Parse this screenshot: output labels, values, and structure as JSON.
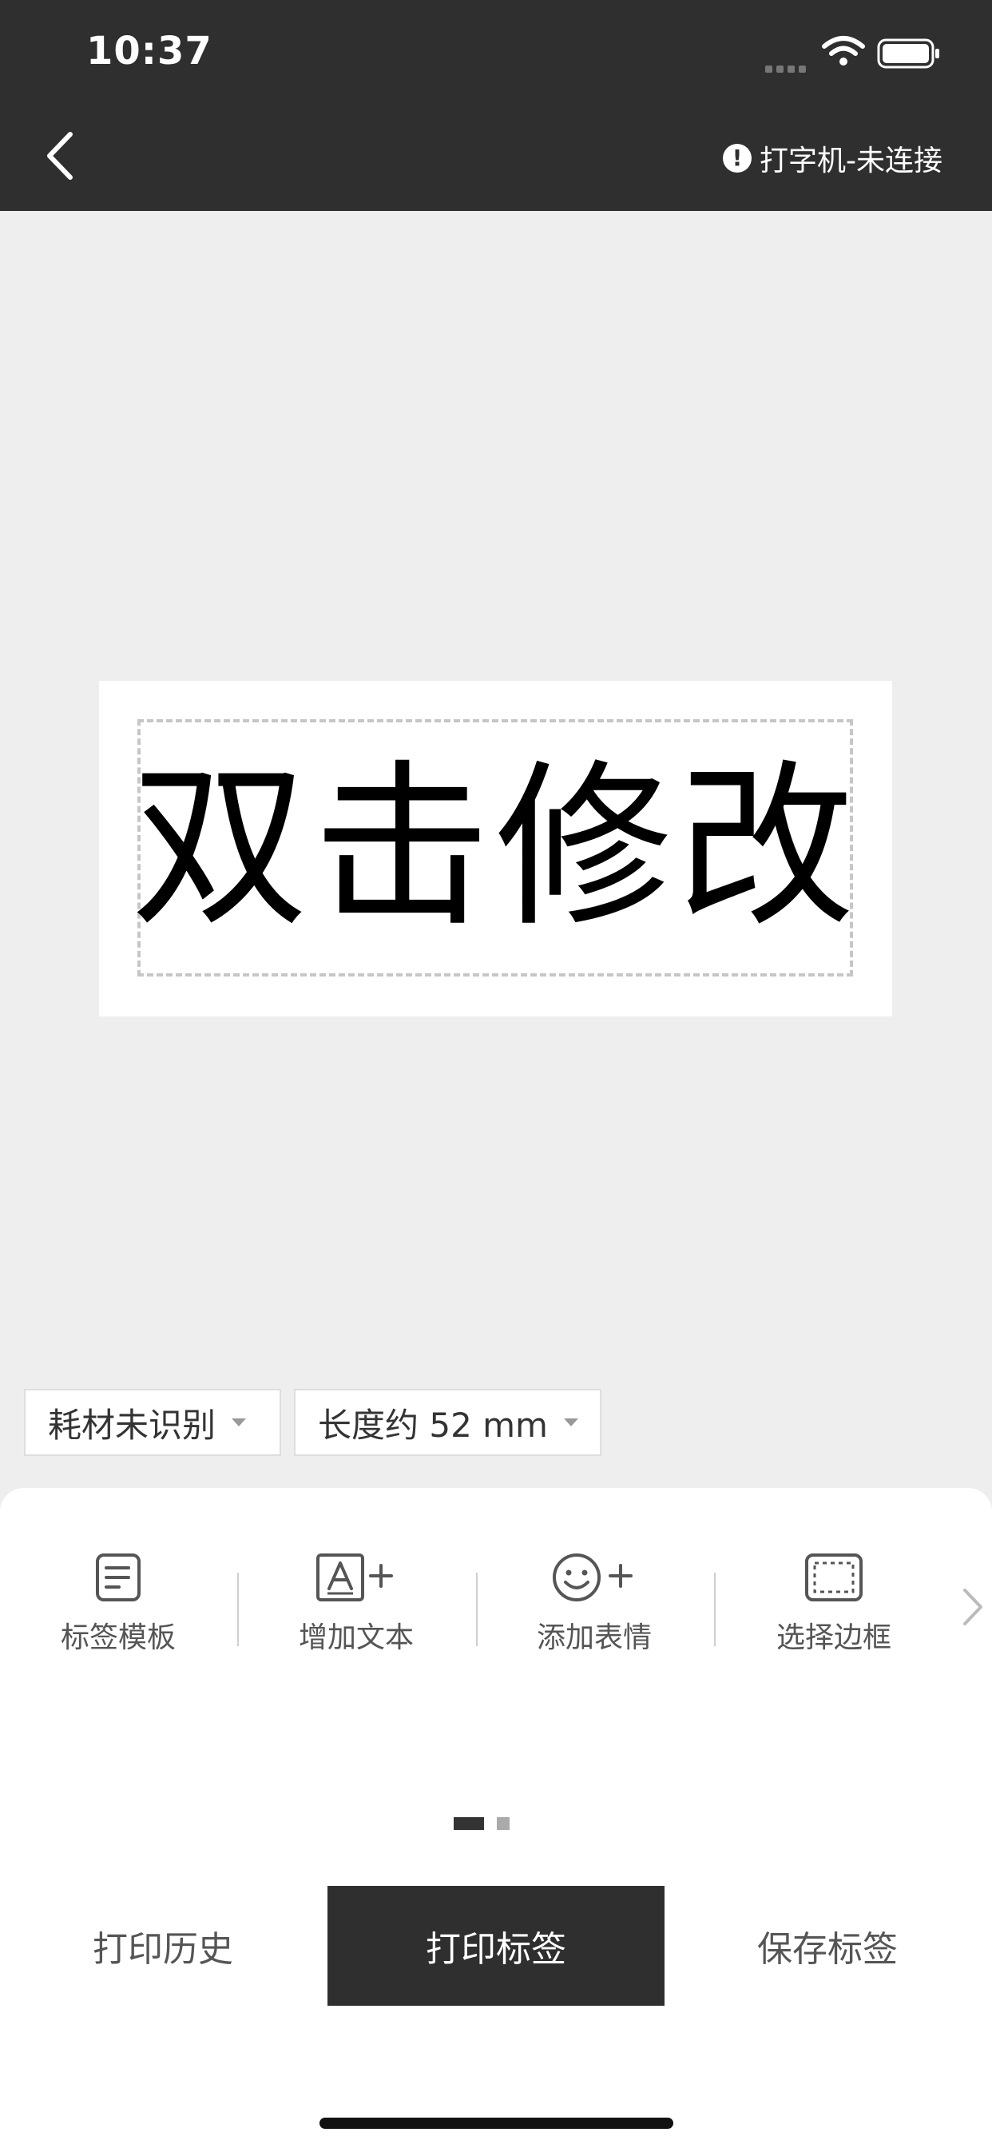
{
  "status_bar": {
    "time": "10:37"
  },
  "header": {
    "printer_status": "打字机-未连接"
  },
  "label": {
    "text": "双击修改"
  },
  "options": {
    "consumable": "耗材未识别",
    "length": "长度约 52 mm"
  },
  "toolbar": {
    "items": [
      {
        "label": "标签模板",
        "icon": "template-icon"
      },
      {
        "label": "增加文本",
        "icon": "add-text-icon"
      },
      {
        "label": "添加表情",
        "icon": "add-emoji-icon"
      },
      {
        "label": "选择边框",
        "icon": "border-icon"
      }
    ]
  },
  "pager": {
    "current": 1,
    "total": 2
  },
  "actions": {
    "print_history": "打印历史",
    "print_label": "打印标签",
    "save_label": "保存标签"
  },
  "colors": {
    "header_bg": "#2f2f2f",
    "canvas_bg": "#eeeeee",
    "primary_button": "#2f2f2f"
  }
}
